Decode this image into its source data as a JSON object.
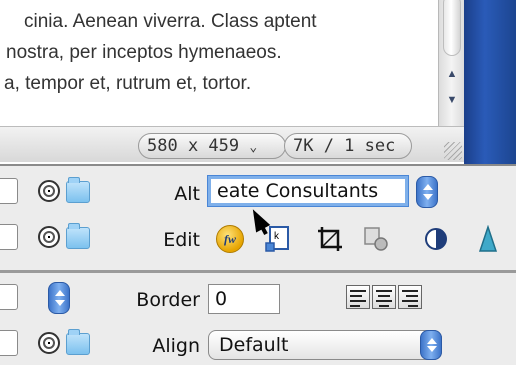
{
  "document": {
    "lines": [
      "cinia. Aenean viverra. Class aptent",
      "nostra, per inceptos hymenaeos.",
      "a, tempor et, rutrum et, tortor."
    ]
  },
  "status": {
    "dimensions": "580 x 459",
    "dimensions_arrow": "⌄",
    "size_time": "7K / 1 sec"
  },
  "inspector": {
    "alt": {
      "label": "Alt",
      "value": "eate Consultants"
    },
    "edit": {
      "label": "Edit",
      "fw_text": "fw"
    },
    "border": {
      "label": "Border",
      "value": "0"
    },
    "align": {
      "label": "Align",
      "selected": "Default"
    }
  },
  "icons": {
    "scroll_up": "up-arrow-icon",
    "scroll_down": "down-arrow-icon",
    "point_to_file": "target-icon",
    "browse_folder": "folder-icon"
  },
  "colors": {
    "accent_blue": "#3d74c9",
    "focus_ring": "#7fb0ea",
    "desktop_blue": "#2a5bb8"
  }
}
